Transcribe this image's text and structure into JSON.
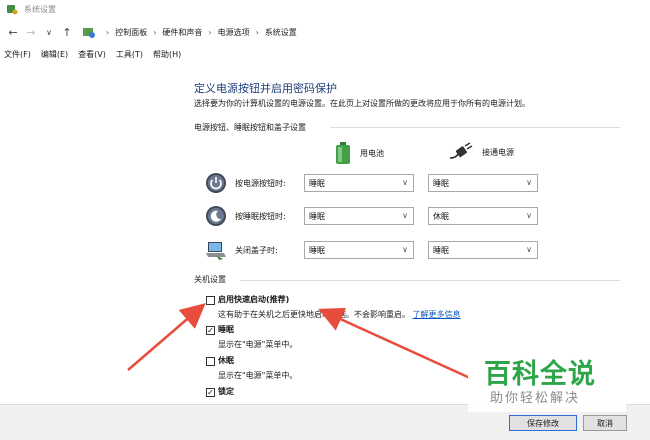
{
  "window": {
    "title": "系统设置"
  },
  "address": {
    "crumbs": [
      "控制面板",
      "硬件和声音",
      "电源选项",
      "系统设置"
    ]
  },
  "menu": [
    "文件(F)",
    "编辑(E)",
    "查看(V)",
    "工具(T)",
    "帮助(H)"
  ],
  "main": {
    "heading": "定义电源按钮并启用密码保护",
    "subtitle": "选择要为你的计算机设置的电源设置。在此页上对设置所做的更改将应用于你所有的电源计划。",
    "power_group_title": "电源按钮、睡眠按钮和盖子设置",
    "col_battery": "用电池",
    "col_plugged": "接通电源",
    "rows": [
      {
        "label": "按电源按钮时:",
        "battery": "睡眠",
        "plugged": "睡眠"
      },
      {
        "label": "按睡眠按钮时:",
        "battery": "睡眠",
        "plugged": "休眠"
      },
      {
        "label": "关闭盖子时:",
        "battery": "睡眠",
        "plugged": "睡眠"
      }
    ],
    "shutdown_group_title": "关机设置",
    "options": [
      {
        "label": "启用快速启动(推荐)",
        "checked": false,
        "desc": "这有助于在关机之后更快地启动电脑。不会影响重启。",
        "link": "了解更多信息"
      },
      {
        "label": "睡眠",
        "checked": true,
        "desc": "显示在\"电源\"菜单中。"
      },
      {
        "label": "休眠",
        "checked": false,
        "desc": "显示在\"电源\"菜单中。"
      },
      {
        "label": "锁定",
        "checked": true
      }
    ]
  },
  "footer": {
    "save": "保存修改",
    "cancel": "取消"
  },
  "watermark": {
    "big": "百科全说",
    "small": "助你轻松解决"
  },
  "colors": {
    "heading": "#1e3d7a",
    "link": "#0b57c5",
    "arrow": "#e74c3c",
    "watermark": "#2fa54a"
  }
}
